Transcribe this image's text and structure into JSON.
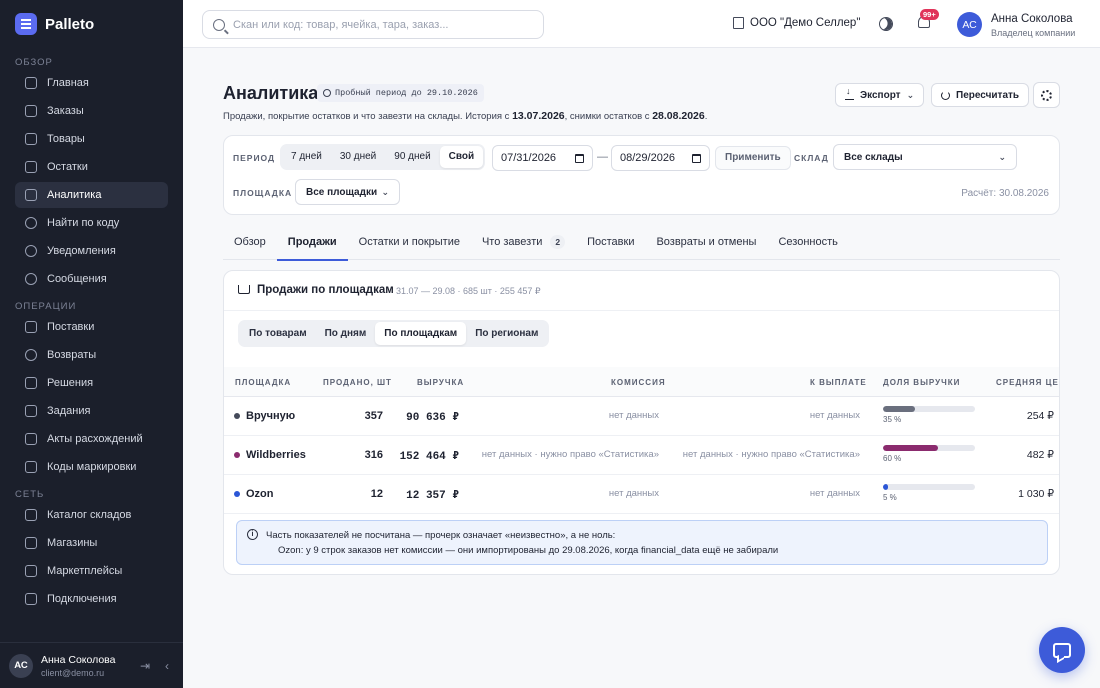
{
  "brand": {
    "name": "Palleto",
    "accent": "#5b6bf0"
  },
  "sidebar": {
    "sections": [
      {
        "title": "ОБЗОР",
        "items": [
          {
            "label": "Главная",
            "icon": "grid-icon"
          },
          {
            "label": "Заказы",
            "icon": "clipboard-icon"
          },
          {
            "label": "Товары",
            "icon": "box-icon"
          },
          {
            "label": "Остатки",
            "icon": "layers-icon"
          },
          {
            "label": "Аналитика",
            "icon": "bar-chart-icon",
            "active": true
          },
          {
            "label": "Найти по коду",
            "icon": "search-icon"
          },
          {
            "label": "Уведомления",
            "icon": "bell-icon"
          },
          {
            "label": "Сообщения",
            "icon": "message-icon"
          }
        ]
      },
      {
        "title": "ОПЕРАЦИИ",
        "items": [
          {
            "label": "Поставки",
            "icon": "truck-icon"
          },
          {
            "label": "Возвраты",
            "icon": "return-icon"
          },
          {
            "label": "Решения",
            "icon": "check-square-icon"
          },
          {
            "label": "Задания",
            "icon": "task-icon"
          },
          {
            "label": "Акты расхождений",
            "icon": "document-icon"
          },
          {
            "label": "Коды маркировки",
            "icon": "barcode-icon"
          }
        ]
      },
      {
        "title": "СЕТЬ",
        "items": [
          {
            "label": "Каталог складов",
            "icon": "warehouse-icon"
          },
          {
            "label": "Магазины",
            "icon": "store-icon"
          },
          {
            "label": "Маркетплейсы",
            "icon": "marketplace-icon"
          },
          {
            "label": "Подключения",
            "icon": "plug-icon"
          }
        ]
      }
    ],
    "user": {
      "initials": "АС",
      "name": "Анна Соколова",
      "email": "client@demo.ru"
    }
  },
  "topbar": {
    "search_placeholder": "Скан или код: товар, ячейка, тара, заказ...",
    "company": "ООО \"Демо Селлер\"",
    "notif_badge": "99+",
    "user": {
      "initials": "АС",
      "name": "Анна Соколова",
      "role": "Владелец компании"
    }
  },
  "page": {
    "title": "Аналитика",
    "trial": "Пробный период до 29.10.2026",
    "subtitle_pre": "Продажи, покрытие остатков и что завезти на склады. История с ",
    "history_date": "13.07.2026",
    "subtitle_mid": ", снимки остатков с ",
    "snapshot_date": "28.08.2026",
    "subtitle_end": ".",
    "export_label": "Экспорт",
    "recalc_label": "Пересчитать"
  },
  "filters": {
    "period_label": "ПЕРИОД",
    "periods": [
      "7 дней",
      "30 дней",
      "90 дней",
      "Свой"
    ],
    "active_period": 3,
    "date_from": "07/31/2026",
    "date_to": "08/29/2026",
    "dash": "—",
    "apply_label": "Применить",
    "warehouse_label": "СКЛАД",
    "warehouse_value": "Все склады",
    "platform_label": "ПЛОЩАДКА",
    "platform_value": "Все площадки",
    "calc_date": "Расчёт: 30.08.2026"
  },
  "tabs": [
    {
      "label": "Обзор"
    },
    {
      "label": "Продажи",
      "active": true
    },
    {
      "label": "Остатки и покрытие"
    },
    {
      "label": "Что завезти",
      "badge": "2"
    },
    {
      "label": "Поставки"
    },
    {
      "label": "Возвраты и отмены"
    },
    {
      "label": "Сезонность"
    }
  ],
  "sales_card": {
    "title": "Продажи по площадкам",
    "meta": "31.07 — 29.08 · 685 шт · 255 457 ₽",
    "views": [
      "По товарам",
      "По дням",
      "По площадкам",
      "По регионам"
    ],
    "active_view": 2,
    "columns": [
      "ПЛОЩАДКА",
      "ПРОДАНО, ШТ",
      "ВЫРУЧКА",
      "КОМИССИЯ",
      "К ВЫПЛАТЕ",
      "ДОЛЯ ВЫРУЧКИ",
      "СРЕДНЯЯ ЦЕНА"
    ],
    "rows": [
      {
        "name": "Вручную",
        "dot": "#444a5a",
        "sold": "357",
        "revenue": "90 636 ₽",
        "commission": "нет данных",
        "payout": "нет данных",
        "share": 35,
        "share_label": "35 %",
        "share_color": "#6a6f7e",
        "avg_price": "254 ₽"
      },
      {
        "name": "Wildberries",
        "dot": "#8b2b6e",
        "sold": "316",
        "revenue": "152 464 ₽",
        "commission": "нет данных · нужно право «Статистика»",
        "payout": "нет данных · нужно право «Статистика»",
        "share": 60,
        "share_label": "60 %",
        "share_color": "#8b2b6e",
        "avg_price": "482 ₽"
      },
      {
        "name": "Ozon",
        "dot": "#2b56d6",
        "sold": "12",
        "revenue": "12 357 ₽",
        "commission": "нет данных",
        "payout": "нет данных",
        "share": 5,
        "share_label": "5 %",
        "share_color": "#2b56d6",
        "avg_price": "1 030 ₽"
      }
    ],
    "note_line1": "Часть показателей не посчитана — прочерк означает «неизвестно», а не ноль:",
    "note_line2": "Ozon: у 9 строк заказов нет комиссии — они импортированы до 29.08.2026, когда financial_data ещё не забирали"
  }
}
